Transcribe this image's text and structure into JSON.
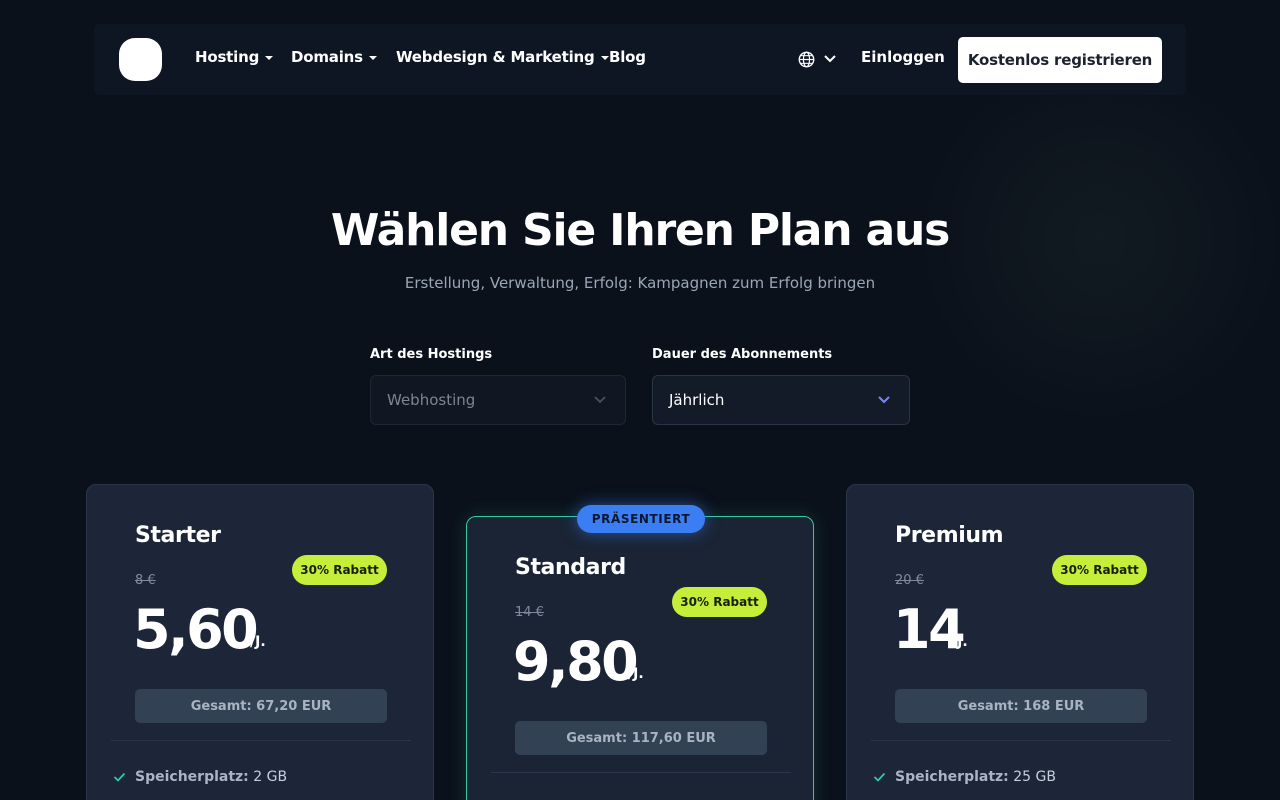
{
  "nav": {
    "items": [
      {
        "label": "Hosting",
        "dropdown": true
      },
      {
        "label": "Domains",
        "dropdown": true
      },
      {
        "label": "Webdesign & Marketing",
        "dropdown": true
      },
      {
        "label": "Blog",
        "dropdown": false
      }
    ],
    "language_icon": "globe-icon",
    "login_label": "Einloggen",
    "register_label": "Kostenlos registrieren"
  },
  "hero": {
    "title": "Wählen Sie Ihren Plan aus",
    "subtitle": "Erstellung, Verwaltung, Erfolg: Kampagnen zum Erfolg bringen"
  },
  "filters": {
    "hosting_type": {
      "label": "Art des Hostings",
      "value": "Webhosting",
      "disabled": true
    },
    "duration": {
      "label": "Dauer des Abonnements",
      "value": "Jährlich"
    }
  },
  "plans": [
    {
      "name": "Starter",
      "old_price": "8 €",
      "discount": "30% Rabatt",
      "price": "5,60",
      "period": "/J.",
      "total": "Gesamt: 67,20 EUR",
      "feature_label": "Speicherplatz:",
      "feature_value": "2 GB",
      "featured": false
    },
    {
      "name": "Standard",
      "old_price": "14 €",
      "discount": "30% Rabatt",
      "price": "9,80",
      "period": "/J.",
      "total": "Gesamt: 117,60 EUR",
      "featured": true,
      "featured_label": "PRÄSENTIERT"
    },
    {
      "name": "Premium",
      "old_price": "20 €",
      "discount": "30% Rabatt",
      "price": "14",
      "period": "/J.",
      "total": "Gesamt: 168 EUR",
      "feature_label": "Speicherplatz:",
      "feature_value": "25 GB",
      "featured": false
    }
  ],
  "colors": {
    "background": "#0b111b",
    "card": "#1c2638",
    "discount_badge": "#c5ee3a",
    "featured_border": "#37c8a0",
    "featured_badge": "#3b7df2",
    "check": "#37c8a0"
  }
}
